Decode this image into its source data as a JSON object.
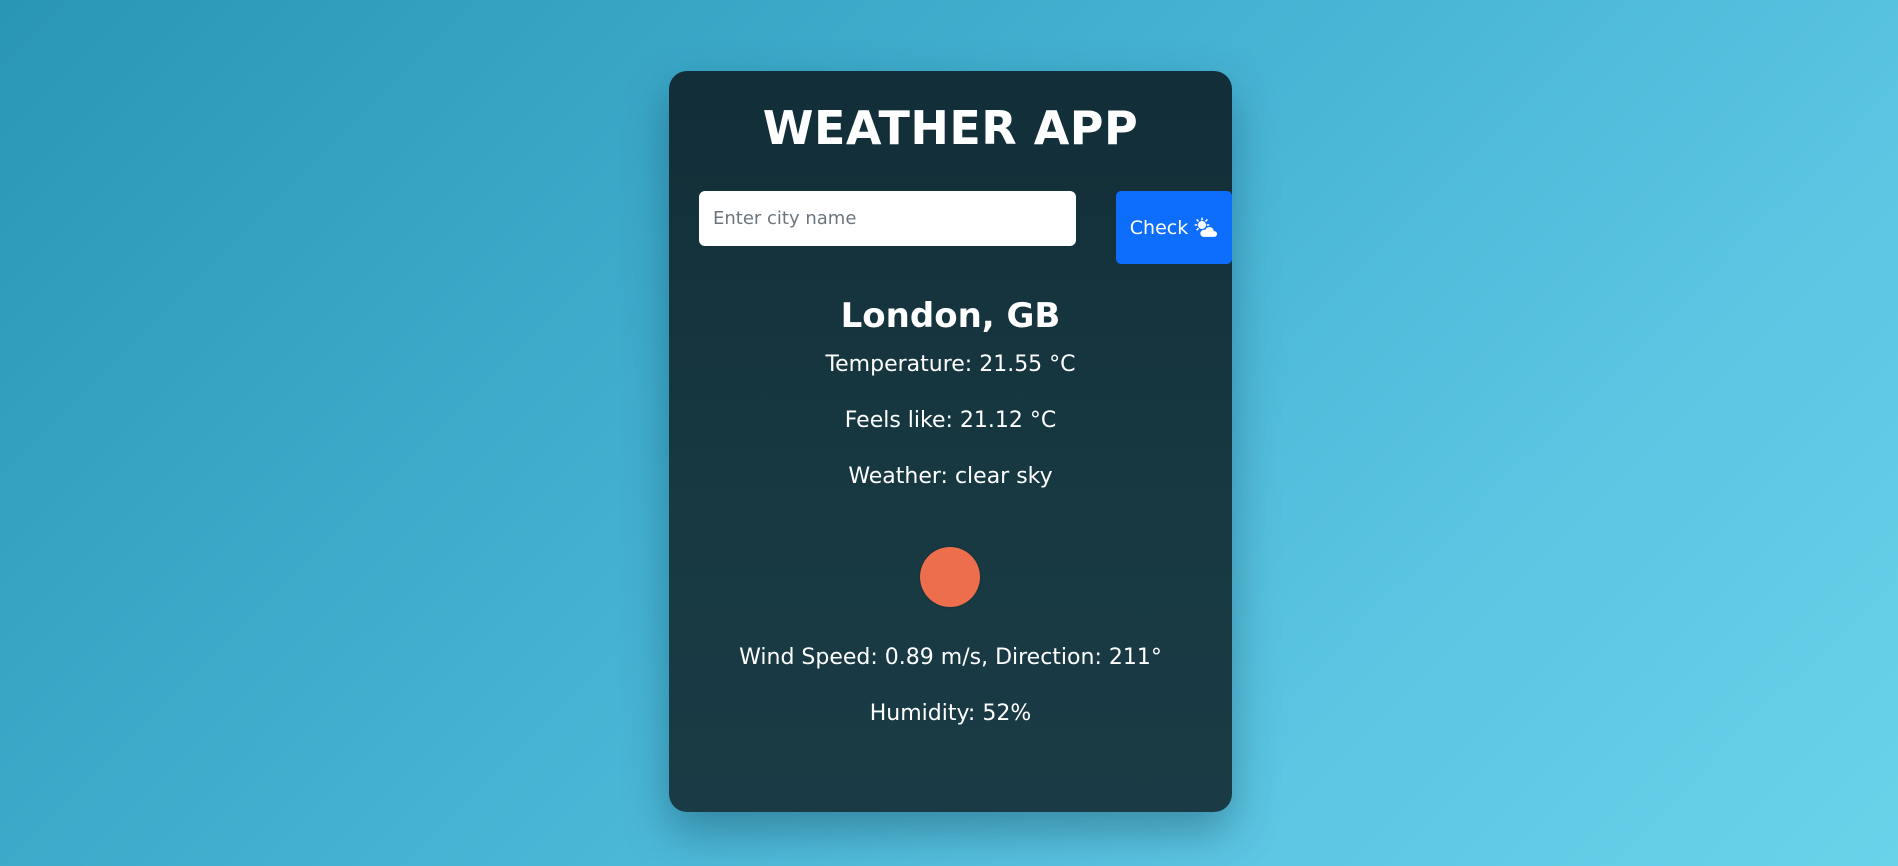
{
  "app": {
    "title": "WEATHER APP"
  },
  "search": {
    "placeholder": "Enter city name",
    "value": "",
    "button_label": "Check",
    "button_icon": "cloud-sun-icon"
  },
  "weather": {
    "location": "London, GB",
    "temperature": "Temperature: 21.55 °C",
    "feels_like": "Feels like: 21.12 °C",
    "description": "Weather: clear sky",
    "icon": "sun-circle-icon",
    "wind": "Wind Speed: 0.89 m/s, Direction: 211°",
    "humidity": "Humidity: 52%"
  },
  "colors": {
    "background_start": "#2a96b5",
    "background_end": "#69d3ea",
    "card": "#163540",
    "button": "#0d6efd",
    "sun": "#ec6e4c",
    "text": "#ffffff"
  }
}
